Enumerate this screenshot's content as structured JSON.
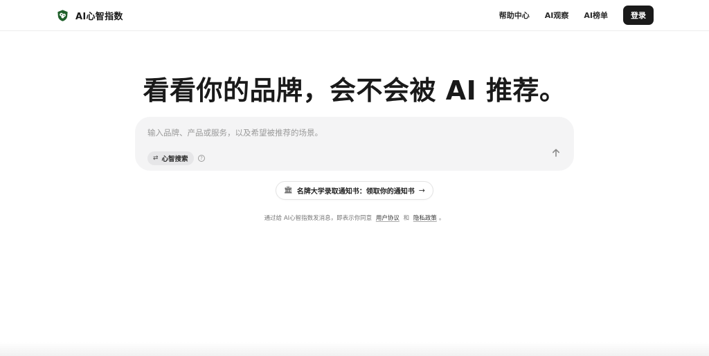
{
  "brand": {
    "name": "AI心智指数",
    "logo_icon": "green-brain-shield-icon",
    "accent": "#1f5f2a"
  },
  "nav": {
    "items": [
      "帮助中心",
      "AI观察",
      "AI榜单"
    ],
    "login_label": "登录"
  },
  "hero": {
    "title": "看看你的品牌，会不会被 AI 推荐。"
  },
  "composer": {
    "placeholder": "输入品牌、产品或服务，以及希望被推荐的场景。",
    "mode_icon": "⇄",
    "mode_label": "心智搜索",
    "help_icon": "?",
    "send_icon": "arrow-up-icon"
  },
  "promo": {
    "emoji": "🏛",
    "text": "名牌大学录取通知书：领取你的通知书",
    "arrow": "→"
  },
  "terms": {
    "prefix": "通过给 AI心智指数发消息，即表示你同意",
    "user_agreement": "用户协议",
    "and": "和",
    "privacy_policy": "隐私政策",
    "suffix": "。"
  }
}
